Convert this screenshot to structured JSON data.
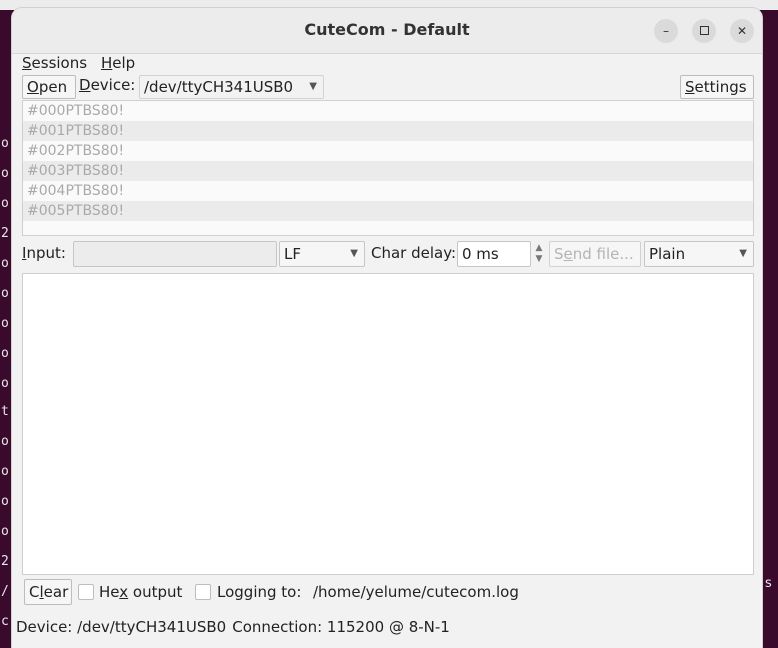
{
  "window": {
    "title": "CuteCom - Default",
    "minimize_glyph": "–",
    "close_glyph": "✕"
  },
  "background_terminal": {
    "left_chars": [
      "o",
      "o",
      "o",
      "2",
      "o",
      "o",
      "o",
      "o",
      "o",
      "t",
      "o",
      "o",
      "o",
      "o",
      "2",
      "/",
      "c"
    ],
    "right_char": "s"
  },
  "menu": {
    "sessions_first": "S",
    "sessions_rest": "essions",
    "help_first": "H",
    "help_rest": "elp"
  },
  "toolbar": {
    "open_first": "O",
    "open_rest": "pen",
    "device_first": "D",
    "device_rest": "evice:",
    "device_value": "/dev/ttyCH341USB0",
    "settings_first": "S",
    "settings_rest": "ettings"
  },
  "history": {
    "items": [
      "#000PTBS80!",
      "#001PTBS80!",
      "#002PTBS80!",
      "#003PTBS80!",
      "#004PTBS80!",
      "#005PTBS80!"
    ]
  },
  "input_bar": {
    "input_first": "I",
    "input_rest": "nput:",
    "input_value": "",
    "line_end": "LF",
    "char_delay_label": "Char delay:",
    "char_delay_value": "0 ms",
    "send_file_pre": "S",
    "send_file_ul": "e",
    "send_file_post": "nd file...",
    "mode": "Plain"
  },
  "bottom_bar": {
    "clear_pre": "C",
    "clear_ul": "l",
    "clear_post": "ear",
    "hex_pre": "He",
    "hex_ul": "x",
    "hex_post": " output",
    "logging_label": "Logging to:",
    "log_path": "/home/yelume/cutecom.log",
    "hex_checked": false,
    "logging_checked": false
  },
  "status": {
    "device": "Device: /dev/ttyCH341USB0",
    "connection": "Connection: 115200 @ 8-N-1"
  }
}
